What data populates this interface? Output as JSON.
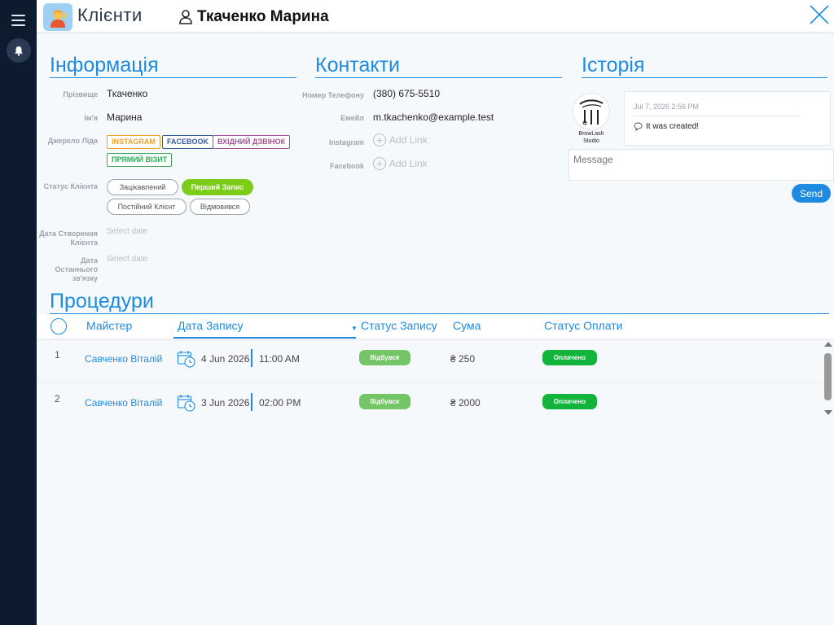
{
  "header": {
    "app_title": "Клієнти",
    "client_name": "Ткаченко Марина"
  },
  "info": {
    "title": "Інформація",
    "surname_label": "Прізвище",
    "surname_value": "Ткаченко",
    "name_label": "Ім'я",
    "name_value": "Марина",
    "lead_source_label": "Джерело Ліда",
    "lead_tags": [
      {
        "label": "INSTAGRAM",
        "color": "#f0a22a"
      },
      {
        "label": "FACEBOOK",
        "color": "#3b5998"
      },
      {
        "label": "ВХІДНИЙ ДЗВІНОК",
        "color": "#a0558f"
      },
      {
        "label": "ПРЯМИЙ ВІЗИТ",
        "color": "#3da55a"
      }
    ],
    "status_label": "Статус Клієнта",
    "statuses": [
      "Зацікавлений",
      "Перший Запис",
      "Постійний Клієнт",
      "Відмовився"
    ],
    "active_status": "Перший Запис",
    "created_label_1": "Дата Створення",
    "created_label_2": "Клієнта",
    "created_placeholder": "Select date",
    "last_contact_label_1": "Дата Останнього",
    "last_contact_label_2": "зв'язку",
    "last_contact_placeholder": "Select date"
  },
  "contacts": {
    "title": "Контакти",
    "phone_label": "Номер Телефону",
    "phone_value": "(380) 675-5510",
    "email_label": "Емейл",
    "email_value": "m.tkachenko@example.test",
    "instagram_label": "Instagram",
    "instagram_action": "Add Link",
    "facebook_label": "Facebook",
    "facebook_action": "Add Link"
  },
  "history": {
    "title": "Історія",
    "studio_name_1": "BrowLash",
    "studio_name_2": "Studio",
    "entries": [
      {
        "date": "Jul 7, 2026 2:56 PM",
        "text": "It was created!"
      }
    ],
    "message_placeholder": "Message",
    "send_label": "Send"
  },
  "procedures": {
    "title": "Процедури",
    "columns": {
      "master": "Майстер",
      "date": "Дата Запису",
      "status": "Статус Запису",
      "sum": "Сума",
      "payment": "Статус Оплати"
    },
    "rows": [
      {
        "num": "1",
        "master": "Савченко Віталій",
        "date": "4 Jun 2026",
        "time": "11:00 AM",
        "status": "Відбувся",
        "sum": "₴ 250",
        "payment": "Оплачено"
      },
      {
        "num": "2",
        "master": "Савченко Віталій",
        "date": "3 Jun 2026",
        "time": "02:00 PM",
        "status": "Відбувся",
        "sum": "₴ 2000",
        "payment": "Оплачено"
      }
    ]
  },
  "colors": {
    "accent": "#1e8be0",
    "rail": "#0d1b2e",
    "active_status": "#7ccd1a",
    "status_badge": "#74c566",
    "payment_badge": "#12b43c"
  }
}
